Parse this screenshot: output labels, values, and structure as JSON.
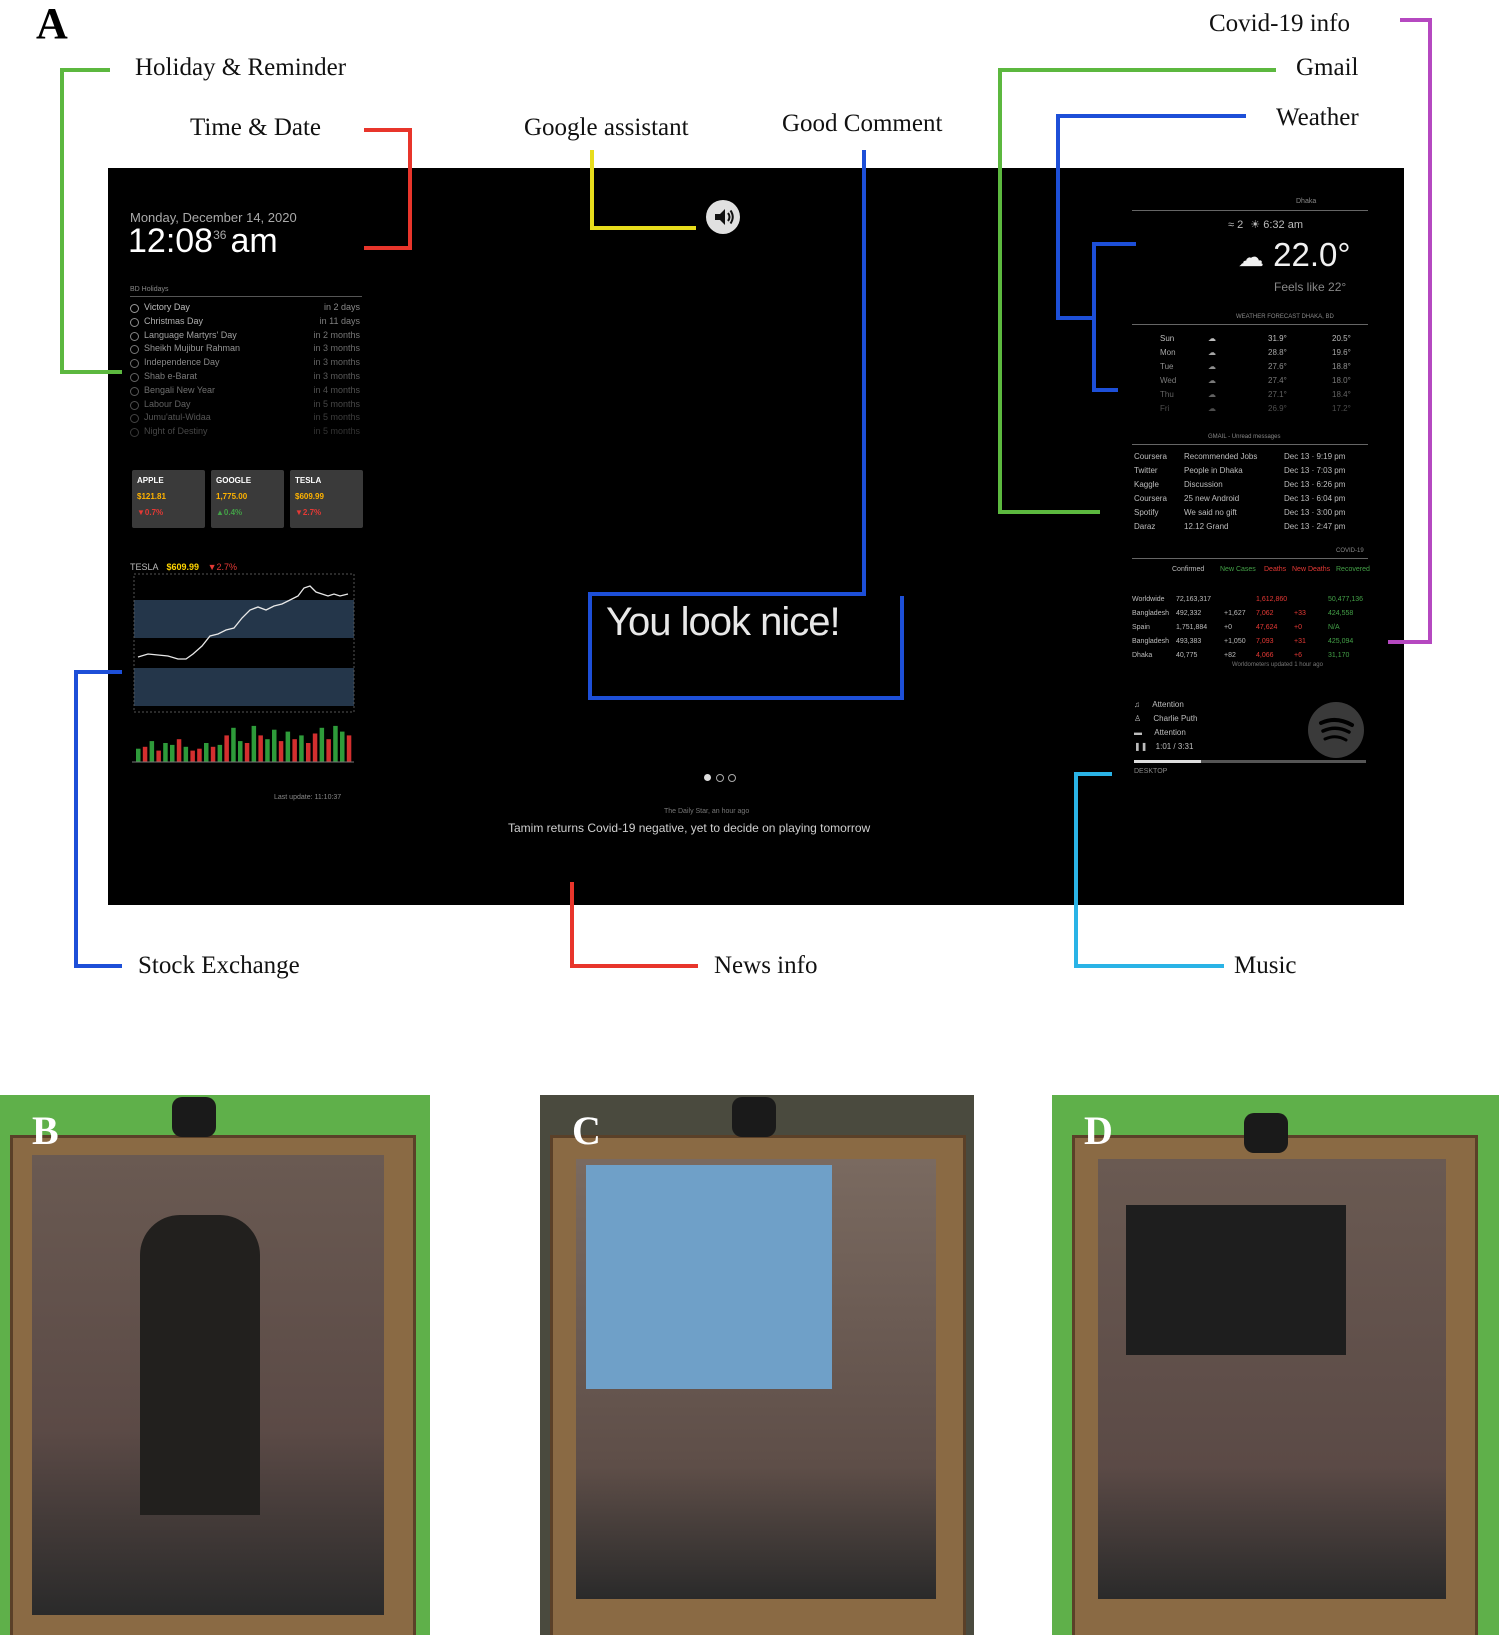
{
  "panel_letters": {
    "a": "A",
    "b": "B",
    "c": "C",
    "d": "D"
  },
  "callouts": {
    "holiday": "Holiday & Reminder",
    "time_date": "Time & Date",
    "google_assistant": "Google assistant",
    "good_comment": "Good Comment",
    "covid": "Covid-19 info",
    "gmail": "Gmail",
    "weather": "Weather",
    "stock": "Stock Exchange",
    "news": "News info",
    "music": "Music"
  },
  "callout_colors": {
    "green": "#5cb83f",
    "red": "#e8352b",
    "yellow": "#e8dd1c",
    "blue": "#1d4fd8",
    "purple": "#b548c0",
    "cyan": "#2ab3e6"
  },
  "screen": {
    "date": "Monday, December 14, 2020",
    "time": "12:08",
    "seconds": "36",
    "ampm": "am",
    "holiday_header": "BD Holidays",
    "holidays": [
      {
        "name": "Victory Day",
        "when": "in 2 days"
      },
      {
        "name": "Christmas Day",
        "when": "in 11 days"
      },
      {
        "name": "Language Martyrs' Day",
        "when": "in 2 months"
      },
      {
        "name": "Sheikh Mujibur Rahman",
        "when": "in 3 months"
      },
      {
        "name": "Independence Day",
        "when": "in 3 months"
      },
      {
        "name": "Shab e-Barat",
        "when": "in 3 months"
      },
      {
        "name": "Bengali New Year",
        "when": "in 4 months"
      },
      {
        "name": "Labour Day",
        "when": "in 5 months"
      },
      {
        "name": "Jumu'atul-Widaa",
        "when": "in 5 months"
      },
      {
        "name": "Night of Destiny",
        "when": "in 5 months"
      }
    ],
    "stocks": [
      {
        "name": "APPLE",
        "price": "$121.81",
        "change": "▼0.7%",
        "color": "#e53935"
      },
      {
        "name": "GOOGLE",
        "price": "1,775.00",
        "change": "▲0.4%",
        "color": "#43a047"
      },
      {
        "name": "TESLA",
        "price": "$609.99",
        "change": "▼2.7%",
        "color": "#e53935"
      }
    ],
    "chart_label": "TESLA",
    "chart_price": "$609.99",
    "chart_change": "▼2.7%",
    "chart_footer": "Last update: 11:10:37",
    "speaker_icon": "speaker-icon",
    "comment": "You look nice!",
    "news_source": "The Daily Star, an hour ago",
    "news_headline": "Tamim returns Covid-19 negative, yet to decide on playing tomorrow",
    "weather_location": "Dhaka",
    "weather_wind": "2",
    "weather_sunrise": "6:32 am",
    "weather_temp": "22.0°",
    "weather_feels": "Feels like 22°",
    "forecast_header": "WEATHER FORECAST DHAKA, BD",
    "forecast": [
      {
        "day": "Sun",
        "hi": "31.9°",
        "lo": "20.5°"
      },
      {
        "day": "Mon",
        "hi": "28.8°",
        "lo": "19.6°"
      },
      {
        "day": "Tue",
        "hi": "27.6°",
        "lo": "18.8°"
      },
      {
        "day": "Wed",
        "hi": "27.4°",
        "lo": "18.0°"
      },
      {
        "day": "Thu",
        "hi": "27.1°",
        "lo": "18.4°"
      },
      {
        "day": "Fri",
        "hi": "26.9°",
        "lo": "17.2°"
      }
    ],
    "gmail_header": "GMAIL - Unread messages",
    "gmail": [
      {
        "from": "Coursera",
        "subject": "Recommended Jobs",
        "date": "Dec 13 · 9:19 pm"
      },
      {
        "from": "Twitter",
        "subject": "People in Dhaka",
        "date": "Dec 13 · 7:03 pm"
      },
      {
        "from": "Kaggle",
        "subject": "Discussion",
        "date": "Dec 13 · 6:26 pm"
      },
      {
        "from": "Coursera",
        "subject": "25 new Android",
        "date": "Dec 13 · 6:04 pm"
      },
      {
        "from": "Spotify",
        "subject": "We said no gift",
        "date": "Dec 13 · 3:00 pm"
      },
      {
        "from": "Daraz",
        "subject": "12.12 Grand",
        "date": "Dec 13 · 2:47 pm"
      }
    ],
    "covid_header": "COVID-19",
    "covid_cols": [
      "Confirmed",
      "New Cases",
      "Deaths",
      "New Deaths",
      "Recovered"
    ],
    "covid": [
      {
        "country": "Worldwide",
        "confirmed": "72,163,317",
        "new_cases": "",
        "deaths": "1,612,860",
        "new_deaths": "",
        "recovered": "50,477,136"
      },
      {
        "country": "Bangladesh",
        "confirmed": "492,332",
        "new_cases": "+1,627",
        "deaths": "7,062",
        "new_deaths": "+33",
        "recovered": "424,558"
      },
      {
        "country": "Spain",
        "confirmed": "1,751,884",
        "new_cases": "+0",
        "deaths": "47,624",
        "new_deaths": "+0",
        "recovered": "N/A"
      },
      {
        "country": "Bangladesh",
        "confirmed": "493,383",
        "new_cases": "+1,050",
        "deaths": "7,093",
        "new_deaths": "+31",
        "recovered": "425,094"
      },
      {
        "country": "Dhaka",
        "confirmed": "40,775",
        "new_cases": "+82",
        "deaths": "4,066",
        "new_deaths": "+6",
        "recovered": "31,170"
      }
    ],
    "covid_footer": "Worldometers updated 1 hour ago",
    "music": {
      "track": "Attention",
      "artist": "Charlie Puth",
      "album": "Attention",
      "time": "1:01 / 3:31",
      "device": "DESKTOP"
    }
  }
}
